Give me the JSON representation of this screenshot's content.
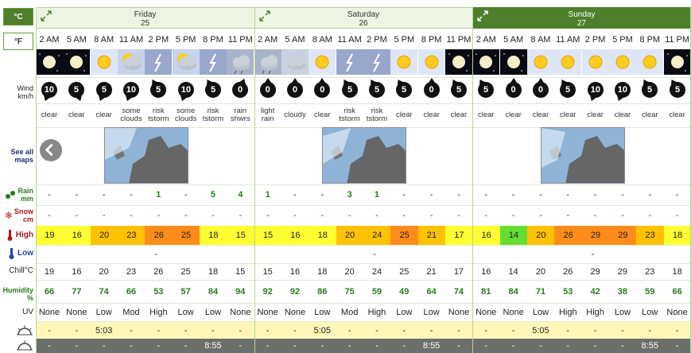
{
  "units": {
    "celsius": "°C",
    "fahrenheit": "°F"
  },
  "labels": {
    "wind": "Wind",
    "wind_unit": "km/h",
    "see_maps_1": "See all",
    "see_maps_2": "maps",
    "rain": "Rain",
    "rain_unit": "mm",
    "snow": "Snow",
    "snow_unit": "cm",
    "high": "High",
    "low": "Low",
    "chill": "Chill°C",
    "humidity": "Humidity",
    "humidity_unit": "%",
    "uv": "UV"
  },
  "days": [
    {
      "name": "Friday",
      "date": "25"
    },
    {
      "name": "Saturday",
      "date": "26"
    },
    {
      "name": "Sunday",
      "date": "27"
    }
  ],
  "times": [
    "2 AM",
    "5 AM",
    "8 AM",
    "11 AM",
    "2 PM",
    "5 PM",
    "8 PM",
    "11 PM",
    "2 AM",
    "5 AM",
    "8 AM",
    "11 AM",
    "2 PM",
    "5 PM",
    "8 PM",
    "11 PM",
    "2 AM",
    "5 AM",
    "8 AM",
    "11 AM",
    "2 PM",
    "5 PM",
    "8 PM",
    "11 PM"
  ],
  "icons": [
    "moon-icon",
    "moon-icon",
    "sun-icon",
    "sun-cloud-icon",
    "lightning-icon",
    "sun-cloud-icon",
    "lightning-icon",
    "cloud-rain-icon",
    "cloud-rain-icon",
    "cloud-icon",
    "sun-icon",
    "lightning-icon",
    "lightning-icon",
    "sun-icon",
    "sun-icon",
    "moon-icon",
    "moon-icon",
    "moon-icon",
    "sun-icon",
    "sun-icon",
    "sun-icon",
    "sun-icon",
    "sun-icon",
    "moon-icon"
  ],
  "wind": [
    "10",
    "5",
    "5",
    "10",
    "5",
    "10",
    "5",
    "0",
    "0",
    "0",
    "0",
    "5",
    "5",
    "5",
    "0",
    "5",
    "5",
    "0",
    "0",
    "5",
    "10",
    "10",
    "5",
    "5"
  ],
  "conditions": [
    [
      "clear"
    ],
    [
      "clear"
    ],
    [
      "clear"
    ],
    [
      "some",
      "clouds"
    ],
    [
      "risk",
      "tstorm"
    ],
    [
      "some",
      "clouds"
    ],
    [
      "risk",
      "tstorm"
    ],
    [
      "rain",
      "shwrs"
    ],
    [
      "light",
      "rain"
    ],
    [
      "cloudy"
    ],
    [
      "clear"
    ],
    [
      "risk",
      "tstorm"
    ],
    [
      "risk",
      "tstorm"
    ],
    [
      "clear"
    ],
    [
      "clear"
    ],
    [
      "clear"
    ],
    [
      "clear"
    ],
    [
      "clear"
    ],
    [
      "clear"
    ],
    [
      "clear"
    ],
    [
      "clear"
    ],
    [
      "clear"
    ],
    [
      "clear"
    ],
    [
      "clear"
    ]
  ],
  "rain": [
    "-",
    "-",
    "-",
    "-",
    "1",
    "-",
    "5",
    "4",
    "1",
    "-",
    "-",
    "3",
    "1",
    "-",
    "-",
    "-",
    "-",
    "-",
    "-",
    "-",
    "-",
    "-",
    "-",
    "-"
  ],
  "snow": [
    "-",
    "-",
    "-",
    "-",
    "-",
    "-",
    "-",
    "-",
    "-",
    "-",
    "-",
    "-",
    "-",
    "-",
    "-",
    "-",
    "-",
    "-",
    "-",
    "-",
    "-",
    "-",
    "-",
    "-"
  ],
  "high": [
    "19",
    "16",
    "20",
    "23",
    "26",
    "25",
    "18",
    "15",
    "15",
    "16",
    "18",
    "20",
    "24",
    "25",
    "21",
    "17",
    "16",
    "14",
    "20",
    "26",
    "29",
    "29",
    "23",
    "18"
  ],
  "high_colors": [
    "#ffff33",
    "#ffff33",
    "#ffc200",
    "#ffc200",
    "#ff8c1a",
    "#ff8c1a",
    "#ffff33",
    "#ffff33",
    "#ffff33",
    "#ffff33",
    "#ffff33",
    "#ffc200",
    "#ffc200",
    "#ff8c1a",
    "#ffc200",
    "#ffff33",
    "#ffff33",
    "#66dd33",
    "#ffc200",
    "#ff8c1a",
    "#ff8c1a",
    "#ff8c1a",
    "#ffc200",
    "#ffff33"
  ],
  "low": [
    "-",
    "-",
    "-"
  ],
  "chill": [
    "19",
    "16",
    "20",
    "23",
    "26",
    "25",
    "18",
    "15",
    "15",
    "16",
    "18",
    "20",
    "24",
    "25",
    "21",
    "17",
    "16",
    "14",
    "20",
    "26",
    "29",
    "29",
    "23",
    "18"
  ],
  "humidity": [
    "66",
    "77",
    "74",
    "66",
    "53",
    "57",
    "84",
    "94",
    "92",
    "92",
    "86",
    "75",
    "59",
    "49",
    "64",
    "74",
    "81",
    "84",
    "71",
    "53",
    "42",
    "38",
    "59",
    "66"
  ],
  "uv": [
    "None",
    "None",
    "Low",
    "Mod",
    "High",
    "Low",
    "Low",
    "None",
    "None",
    "None",
    "Low",
    "Mod",
    "High",
    "Low",
    "Low",
    "None",
    "None",
    "None",
    "Low",
    "High",
    "High",
    "Low",
    "Low",
    "None"
  ],
  "sunrise": [
    "-",
    "-",
    "5:03",
    "-",
    "-",
    "-",
    "-",
    "-",
    "-",
    "-",
    "5:05",
    "-",
    "-",
    "-",
    "-",
    "-",
    "-",
    "-",
    "5:05",
    "-",
    "-",
    "-",
    "-",
    "-"
  ],
  "sunset": [
    "-",
    "-",
    "-",
    "-",
    "-",
    "-",
    "8:55",
    "-",
    "-",
    "-",
    "-",
    "-",
    "-",
    "-",
    "8:55",
    "-",
    "-",
    "-",
    "-",
    "-",
    "-",
    "-",
    "8:55",
    "-"
  ]
}
